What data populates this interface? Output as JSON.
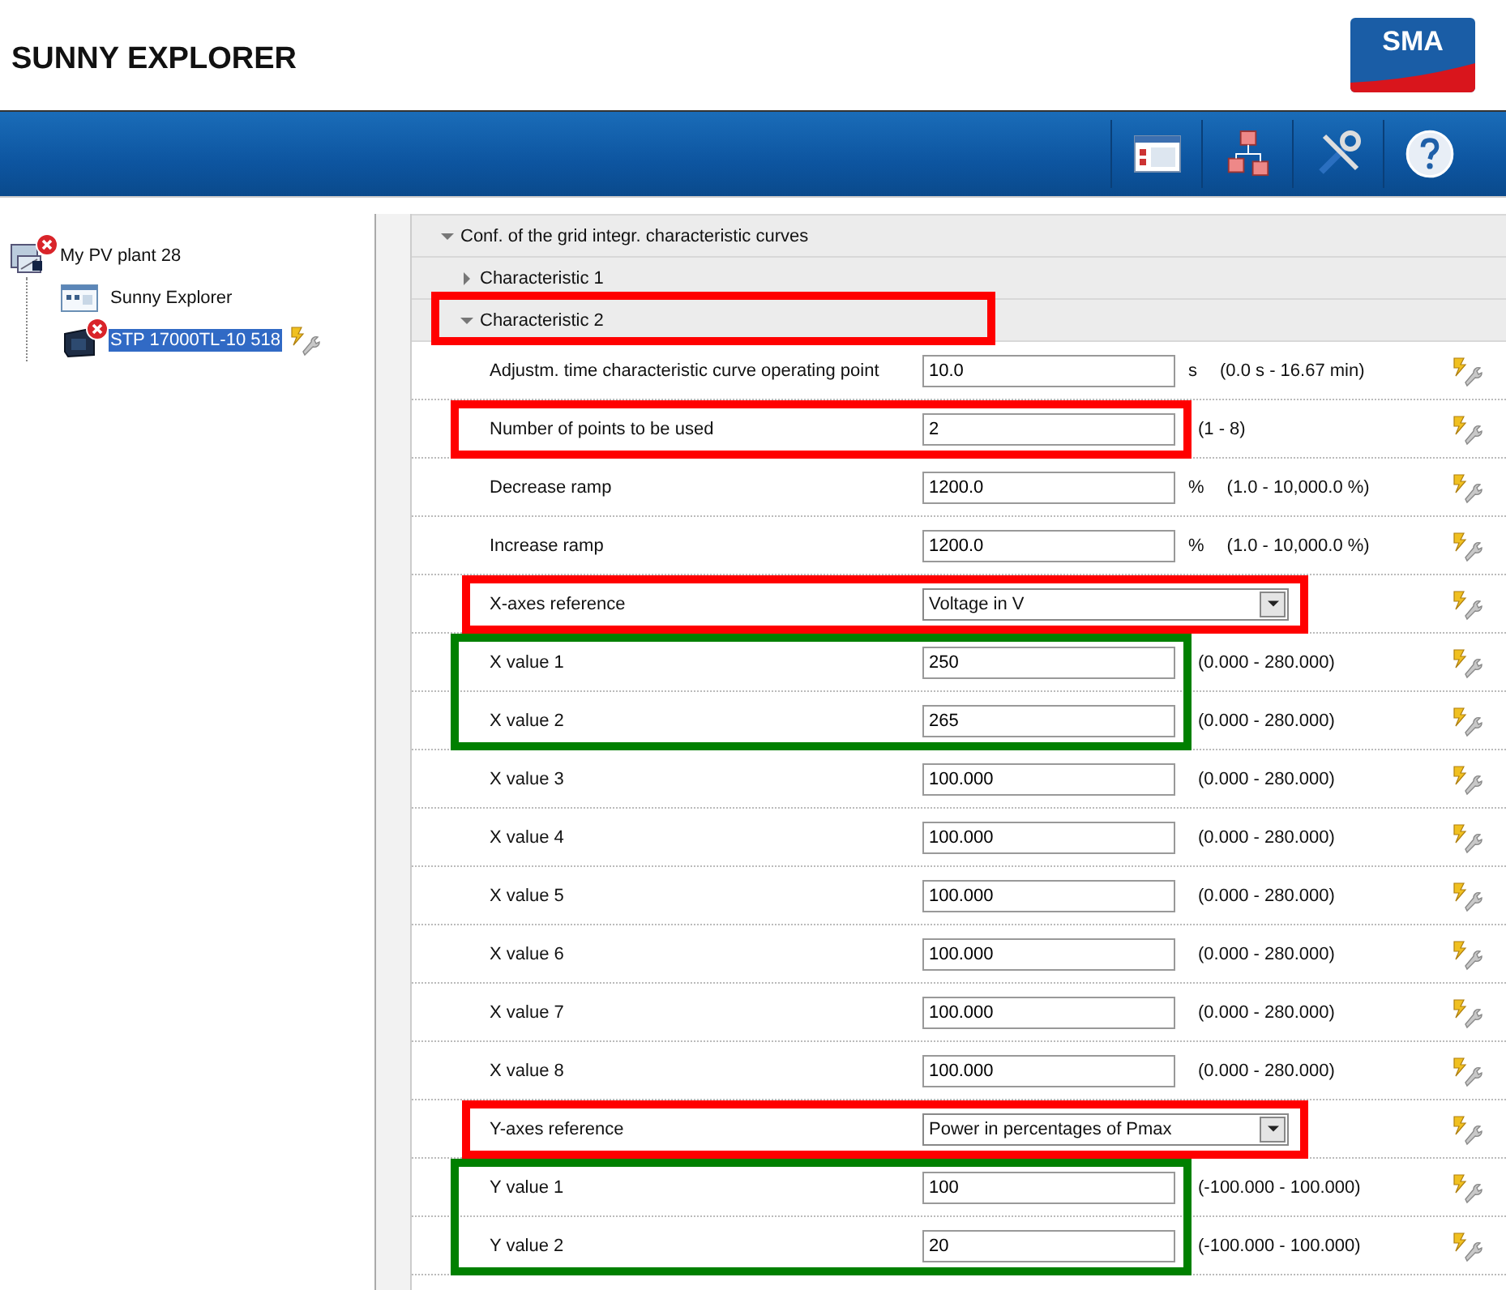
{
  "app": {
    "title": "SUNNY EXPLORER",
    "logo": "SMA"
  },
  "toolbar": [
    {
      "kind": "window"
    },
    {
      "kind": "network"
    },
    {
      "kind": "tools"
    },
    {
      "kind": "help"
    }
  ],
  "tree": [
    {
      "label": "My PV plant 28",
      "kind": "plant",
      "error": true,
      "selected": false,
      "children": [
        {
          "label": "Sunny Explorer",
          "kind": "explorer",
          "error": false,
          "selected": false
        },
        {
          "label": "STP 17000TL-10 518",
          "kind": "inverter",
          "error": true,
          "selected": true
        }
      ]
    }
  ],
  "sections": [
    {
      "title": "Conf. of the grid integr. characteristic curves",
      "expanded": true,
      "children": [
        {
          "title": "Characteristic 1",
          "expanded": false
        },
        {
          "title": "Characteristic 2",
          "expanded": true,
          "color": "#ff0000",
          "params": [
            {
              "kind": "text",
              "label": "Adjustm. time characteristic curve operating point",
              "value": "10.0",
              "unit": "s",
              "range": "(0.0  s - 16.67  min)"
            },
            {
              "kind": "text",
              "label": "Number of points to be used",
              "value": "2",
              "range": "(1 - 8)",
              "color": "#ff0000"
            },
            {
              "kind": "text",
              "label": "Decrease ramp",
              "value": "1200.0",
              "unit": "%",
              "range": "(1.0 - 10,000.0  %)"
            },
            {
              "kind": "text",
              "label": "Increase ramp",
              "value": "1200.0",
              "unit": "%",
              "range": "(1.0 - 10,000.0  %)"
            },
            {
              "kind": "select",
              "label": "X-axes reference",
              "value": "Voltage in V",
              "color": "#ff0000"
            },
            {
              "kind": "text",
              "label": "X value 1",
              "value": "250",
              "range": "(0.000 - 280.000)",
              "color": "#008000"
            },
            {
              "kind": "text",
              "label": "X value 2",
              "value": "265",
              "range": "(0.000 - 280.000)",
              "color": "#008000"
            },
            {
              "kind": "text",
              "label": "X value 3",
              "value": "100.000",
              "range": "(0.000 - 280.000)"
            },
            {
              "kind": "text",
              "label": "X value 4",
              "value": "100.000",
              "range": "(0.000 - 280.000)"
            },
            {
              "kind": "text",
              "label": "X value 5",
              "value": "100.000",
              "range": "(0.000 - 280.000)"
            },
            {
              "kind": "text",
              "label": "X value 6",
              "value": "100.000",
              "range": "(0.000 - 280.000)"
            },
            {
              "kind": "text",
              "label": "X value 7",
              "value": "100.000",
              "range": "(0.000 - 280.000)"
            },
            {
              "kind": "text",
              "label": "X value 8",
              "value": "100.000",
              "range": "(0.000 - 280.000)"
            },
            {
              "kind": "select",
              "label": "Y-axes reference",
              "value": "Power in percentages of Pmax",
              "color": "#ff0000"
            },
            {
              "kind": "text",
              "label": "Y value 1",
              "value": "100",
              "range": "(-100.000 - 100.000)",
              "color": "#008000"
            },
            {
              "kind": "text",
              "label": "Y value 2",
              "value": "20",
              "range": "(-100.000 - 100.000)",
              "color": "#008000"
            }
          ]
        }
      ]
    }
  ]
}
